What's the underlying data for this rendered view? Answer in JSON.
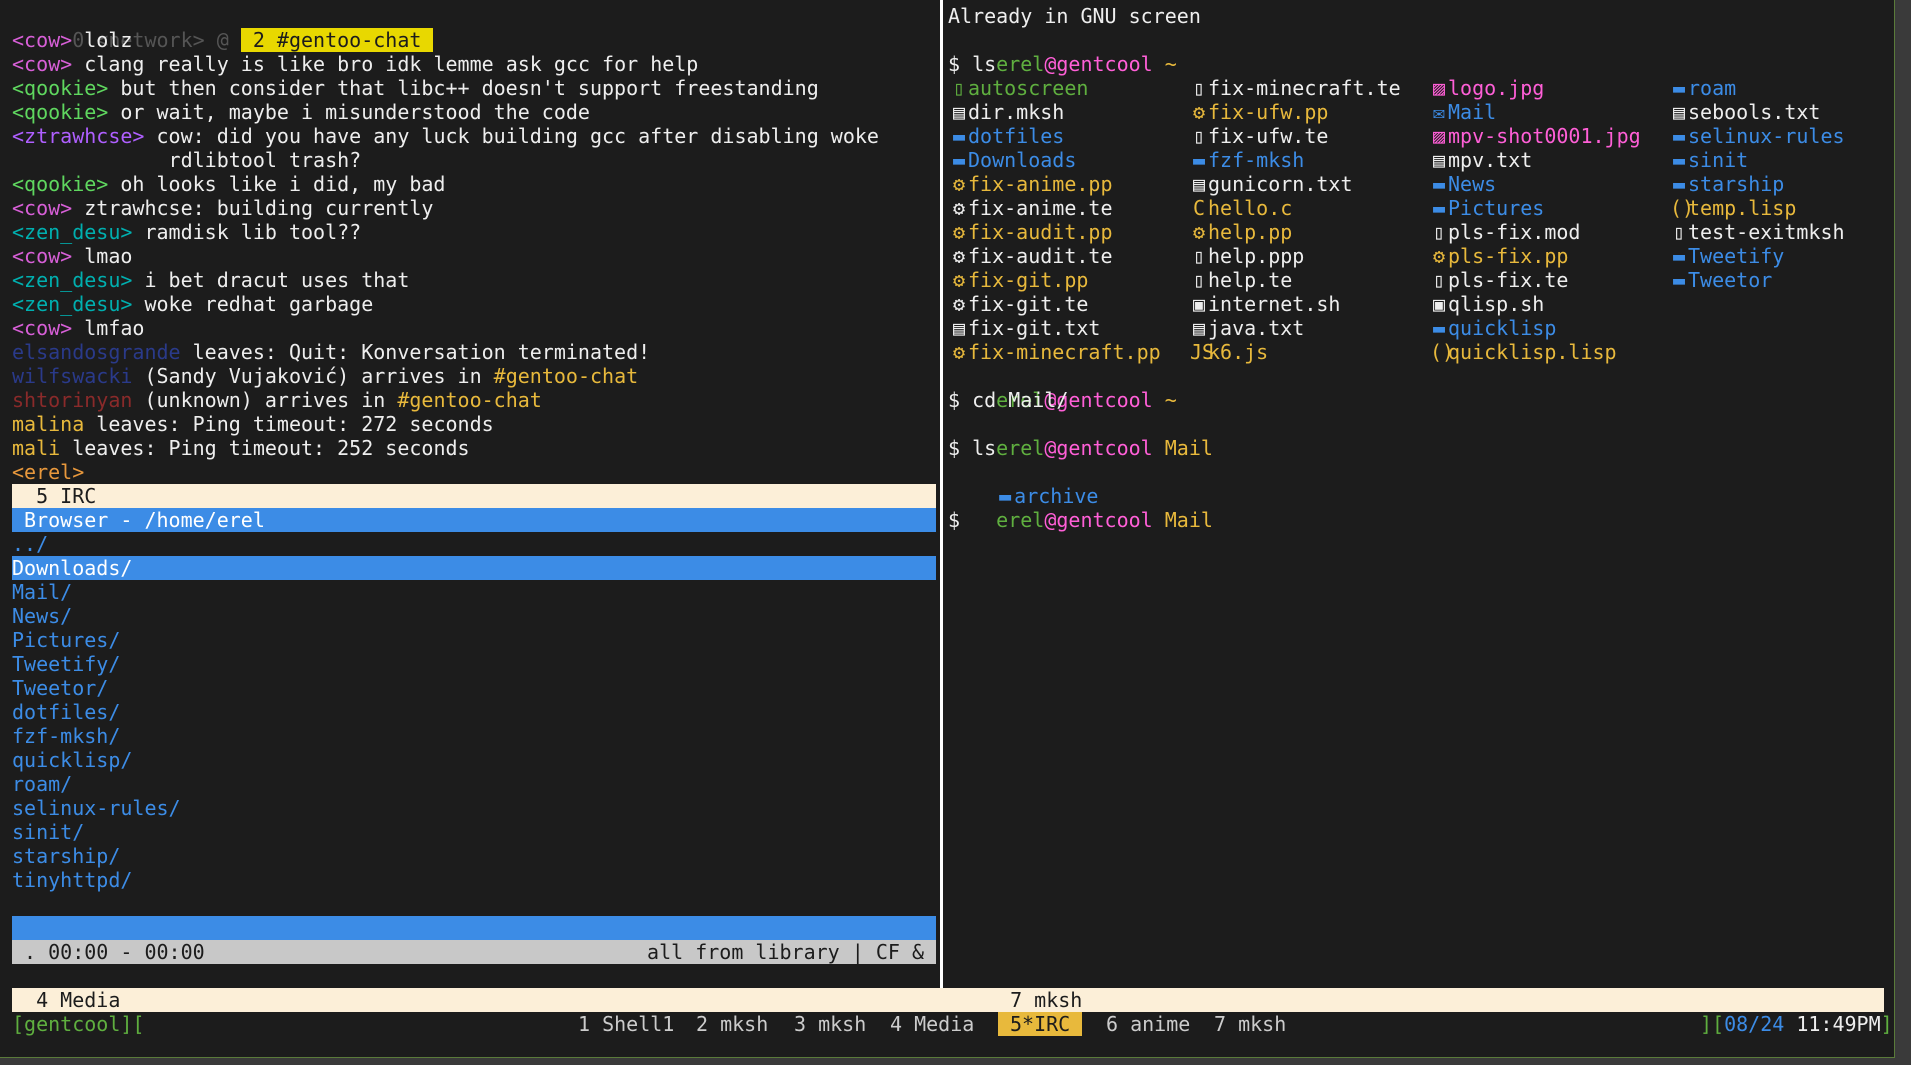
{
  "left_pane": {
    "header_network": " 0 <network> @ ",
    "header_channel": " 2 #gentoo-chat ",
    "messages": [
      {
        "nick": "<cow>",
        "text": " lolz",
        "cls": "nick-cow"
      },
      {
        "nick": "<cow>",
        "text": " clang really is like bro idk lemme ask gcc for help",
        "cls": "nick-cow"
      },
      {
        "nick": "<qookie>",
        "text": " but then consider that libc++ doesn't support freestanding",
        "cls": "nick-qookie"
      },
      {
        "nick": "<qookie>",
        "text": " or wait, maybe i misunderstood the code",
        "cls": "nick-qookie"
      },
      {
        "nick": "<ztrawhcse>",
        "text": " cow: did you have any luck building gcc after disabling woke",
        "cls": "nick-ztr"
      },
      {
        "nick": "",
        "text": "             rdlibtool trash?",
        "cls": ""
      },
      {
        "nick": "<qookie>",
        "text": " oh looks like i did, my bad",
        "cls": "nick-qookie"
      },
      {
        "nick": "<cow>",
        "text": " ztrawhcse: building currently",
        "cls": "nick-cow"
      },
      {
        "nick": "<zen_desu>",
        "text": " ramdisk lib tool??",
        "cls": "nick-zen"
      },
      {
        "nick": "<cow>",
        "text": " lmao",
        "cls": "nick-cow"
      },
      {
        "nick": "<zen_desu>",
        "text": " i bet dracut uses that",
        "cls": "nick-zen"
      },
      {
        "nick": "<zen_desu>",
        "text": " woke redhat garbage",
        "cls": "nick-zen"
      },
      {
        "nick": "<cow>",
        "text": " lmfao",
        "cls": "nick-cow"
      }
    ],
    "events": [
      {
        "who": "elsandosgrande",
        "rest": " leaves: Quit: Konversation terminated!",
        "who_color": "#2a3a8a"
      },
      {
        "who": "wilfswacki",
        "rest": " (Sandy Vujaković) arrives in ",
        "chan": "#gentoo-chat",
        "who_color": "#2a3a8a"
      },
      {
        "who": "shtorinyan",
        "rest": " (unknown) arrives in ",
        "chan": "#gentoo-chat",
        "who_color": "#8a2a2a"
      },
      {
        "who": "malina",
        "rest": " leaves: Ping timeout: 272 seconds",
        "who_color": "#e8b93c"
      },
      {
        "who": "mali",
        "rest": " leaves: Ping timeout: 252 seconds",
        "who_color": "#e8b93c"
      }
    ],
    "prompt": "<erel>",
    "irc_status": "  5 IRC",
    "browser_title": " Browser - /home/erel",
    "browser_items": [
      "../",
      "Downloads/",
      "Mail/",
      "News/",
      "Pictures/",
      "Tweetify/",
      "Tweetor/",
      "dotfiles/",
      "fzf-mksh/",
      "quicklisp/",
      "roam/",
      "selinux-rules/",
      "sinit/",
      "starship/",
      "tinyhttpd/"
    ],
    "player_time": " . 00:00 - 00:00",
    "player_right": "all from library | CF &",
    "media_status": "  4 Media"
  },
  "right_pane": {
    "banner": "Already in GNU screen",
    "user": "erel",
    "host": "@gentcool",
    "home": " ~",
    "cmd_ls": "$ ls",
    "ls_cols": [
      [
        {
          "name": "autoscreen",
          "icon": "▯",
          "color": "#5faf3f"
        },
        {
          "name": "dir.mksh",
          "icon": "▤",
          "color": "#eeeeee"
        },
        {
          "name": "dotfiles",
          "icon": "▬",
          "color": "#3c8ce6"
        },
        {
          "name": "Downloads",
          "icon": "▬",
          "color": "#3c8ce6"
        },
        {
          "name": "fix-anime.pp",
          "icon": "⚙",
          "color": "#e8b93c"
        },
        {
          "name": "fix-anime.te",
          "icon": "⚙",
          "color": "#eeeeee"
        },
        {
          "name": "fix-audit.pp",
          "icon": "⚙",
          "color": "#e8b93c"
        },
        {
          "name": "fix-audit.te",
          "icon": "⚙",
          "color": "#eeeeee"
        },
        {
          "name": "fix-git.pp",
          "icon": "⚙",
          "color": "#e8b93c"
        },
        {
          "name": "fix-git.te",
          "icon": "⚙",
          "color": "#eeeeee"
        },
        {
          "name": "fix-git.txt",
          "icon": "▤",
          "color": "#eeeeee"
        },
        {
          "name": "fix-minecraft.pp",
          "icon": "⚙",
          "color": "#e8b93c"
        }
      ],
      [
        {
          "name": "fix-minecraft.te",
          "icon": "▯",
          "color": "#eeeeee"
        },
        {
          "name": "fix-ufw.pp",
          "icon": "⚙",
          "color": "#e8b93c"
        },
        {
          "name": "fix-ufw.te",
          "icon": "▯",
          "color": "#eeeeee"
        },
        {
          "name": "fzf-mksh",
          "icon": "▬",
          "color": "#3c8ce6"
        },
        {
          "name": "gunicorn.txt",
          "icon": "▤",
          "color": "#eeeeee"
        },
        {
          "name": "hello.c",
          "icon": "C",
          "color": "#e8b93c"
        },
        {
          "name": "help.pp",
          "icon": "⚙",
          "color": "#e8b93c"
        },
        {
          "name": "help.ppp",
          "icon": "▯",
          "color": "#eeeeee"
        },
        {
          "name": "help.te",
          "icon": "▯",
          "color": "#eeeeee"
        },
        {
          "name": "internet.sh",
          "icon": "▣",
          "color": "#eeeeee"
        },
        {
          "name": "java.txt",
          "icon": "▤",
          "color": "#eeeeee"
        },
        {
          "name": "k6.js",
          "icon": "JS",
          "color": "#e8b93c"
        }
      ],
      [
        {
          "name": "logo.jpg",
          "icon": "▨",
          "color": "#ff5fd7"
        },
        {
          "name": "Mail",
          "icon": "✉",
          "color": "#3c8ce6"
        },
        {
          "name": "mpv-shot0001.jpg",
          "icon": "▨",
          "color": "#ff5fd7"
        },
        {
          "name": "mpv.txt",
          "icon": "▤",
          "color": "#eeeeee"
        },
        {
          "name": "News",
          "icon": "▬",
          "color": "#3c8ce6"
        },
        {
          "name": "Pictures",
          "icon": "▬",
          "color": "#3c8ce6"
        },
        {
          "name": "pls-fix.mod",
          "icon": "▯",
          "color": "#eeeeee"
        },
        {
          "name": "pls-fix.pp",
          "icon": "⚙",
          "color": "#e8b93c"
        },
        {
          "name": "pls-fix.te",
          "icon": "▯",
          "color": "#eeeeee"
        },
        {
          "name": "qlisp.sh",
          "icon": "▣",
          "color": "#eeeeee"
        },
        {
          "name": "quicklisp",
          "icon": "▬",
          "color": "#3c8ce6"
        },
        {
          "name": "quicklisp.lisp",
          "icon": "()",
          "color": "#e8b93c"
        }
      ],
      [
        {
          "name": "roam",
          "icon": "▬",
          "color": "#3c8ce6"
        },
        {
          "name": "sebools.txt",
          "icon": "▤",
          "color": "#eeeeee"
        },
        {
          "name": "selinux-rules",
          "icon": "▬",
          "color": "#3c8ce6"
        },
        {
          "name": "sinit",
          "icon": "▬",
          "color": "#3c8ce6"
        },
        {
          "name": "starship",
          "icon": "▬",
          "color": "#3c8ce6"
        },
        {
          "name": "temp.lisp",
          "icon": "()",
          "color": "#e8b93c"
        },
        {
          "name": "test-exitmksh",
          "icon": "▯",
          "color": "#eeeeee"
        },
        {
          "name": "Tweetify",
          "icon": "▬",
          "color": "#3c8ce6"
        },
        {
          "name": "Tweetor",
          "icon": "▬",
          "color": "#3c8ce6"
        }
      ]
    ],
    "cmd_cd": "$ cd Mail/",
    "mail_dir": " Mail",
    "archive": "archive",
    "final_prompt": "$",
    "mksh_status": "  7 mksh"
  },
  "tabbar": {
    "host": "[gentcool][",
    "tabs": [
      "1 Shell1",
      "2 mksh",
      "3 mksh",
      "4 Media",
      "5*IRC",
      "6 anime",
      "7 mksh"
    ],
    "active_index": 4,
    "bracket": "][",
    "date": "08/24",
    "time": " 11:49PM",
    "close": "]"
  }
}
